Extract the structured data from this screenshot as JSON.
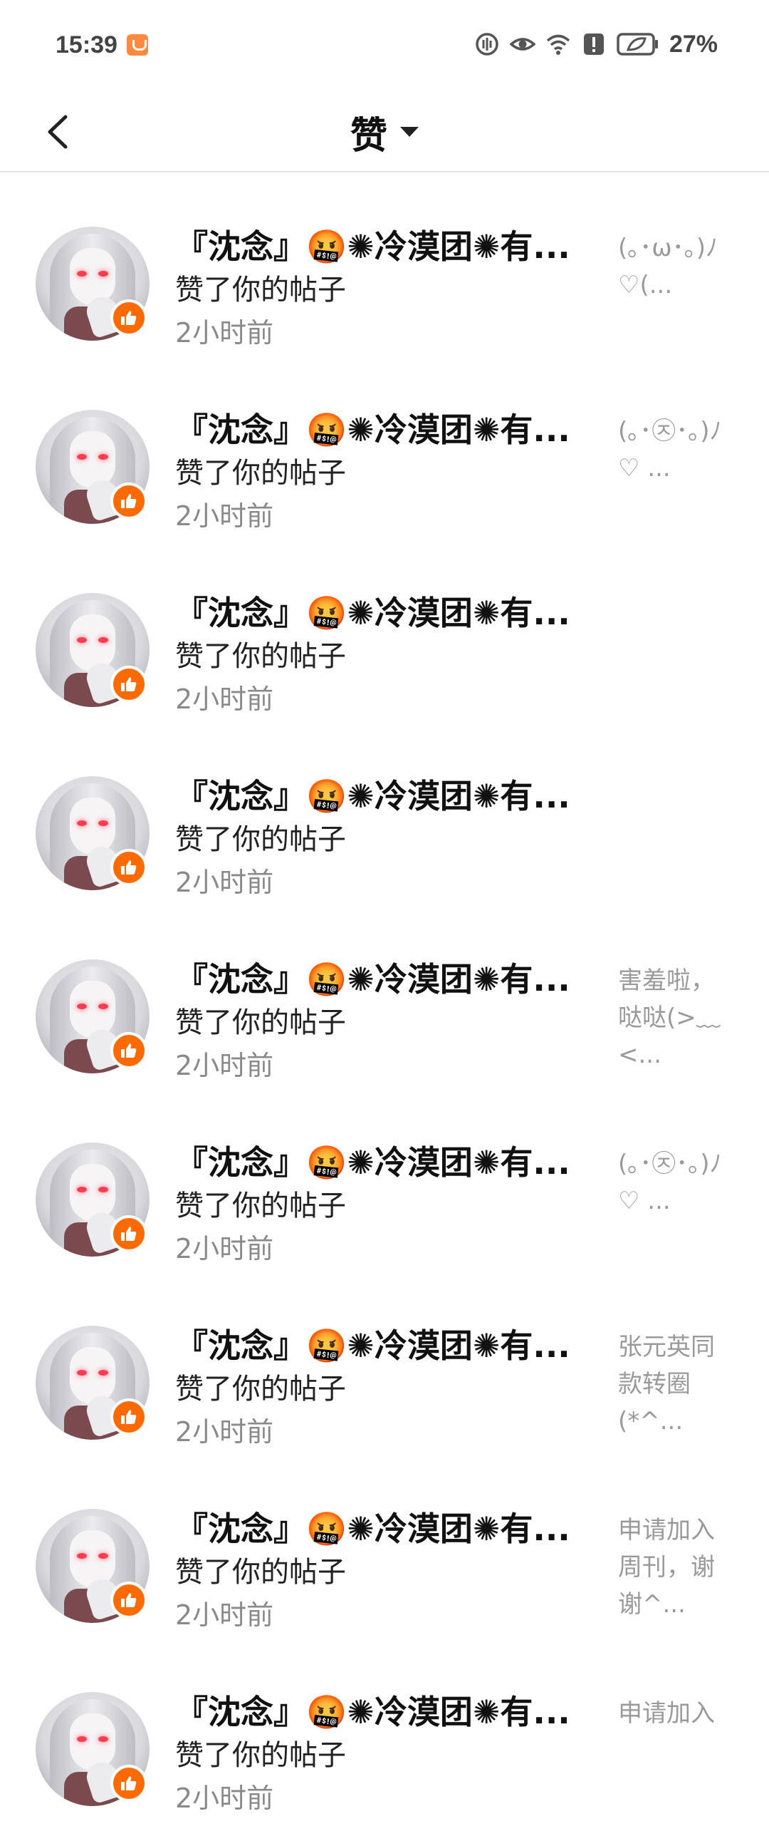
{
  "status_bar": {
    "time": "15:39",
    "battery_percent": "27%",
    "icons": [
      "app-notification-icon",
      "data-saver-icon",
      "eye-icon",
      "wifi-icon",
      "alert-icon",
      "battery-saver-icon"
    ]
  },
  "header": {
    "title": "赞",
    "back_icon": "chevron-left-icon",
    "dropdown_icon": "caret-down-icon"
  },
  "colors": {
    "accent": "#ff6a00",
    "secondary_text": "#8a8a8a",
    "divider": "#e6e6e6"
  },
  "notifications": [
    {
      "name": "『沈念』🤬✺冷漠团✺有...",
      "action": "赞了你的帖子",
      "time": "2小时前",
      "preview": "(｡･ω･｡)ﾉ\n♡(..."
    },
    {
      "name": "『沈念』🤬✺冷漠团✺有...",
      "action": "赞了你的帖子",
      "time": "2小时前",
      "preview": "(｡･㉨･｡)ﾉ\n♡ ..."
    },
    {
      "name": "『沈念』🤬✺冷漠团✺有...",
      "action": "赞了你的帖子",
      "time": "2小时前",
      "preview": ""
    },
    {
      "name": "『沈念』🤬✺冷漠团✺有...",
      "action": "赞了你的帖子",
      "time": "2小时前",
      "preview": ""
    },
    {
      "name": "『沈念』🤬✺冷漠团✺有...",
      "action": "赞了你的帖子",
      "time": "2小时前",
      "preview": "害羞啦，\n哒哒(>﹏\n<..."
    },
    {
      "name": "『沈念』🤬✺冷漠团✺有...",
      "action": "赞了你的帖子",
      "time": "2小时前",
      "preview": "(｡･㉨･｡)ﾉ\n♡ ..."
    },
    {
      "name": "『沈念』🤬✺冷漠团✺有...",
      "action": "赞了你的帖子",
      "time": "2小时前",
      "preview": "张元英同\n款转圈\n(*^..."
    },
    {
      "name": "『沈念』🤬✺冷漠团✺有...",
      "action": "赞了你的帖子",
      "time": "2小时前",
      "preview": "申请加入\n周刊，谢\n谢^..."
    },
    {
      "name": "『沈念』🤬✺冷漠团✺有...",
      "action": "赞了你的帖子",
      "time": "2小时前",
      "preview": "申请加入"
    }
  ]
}
